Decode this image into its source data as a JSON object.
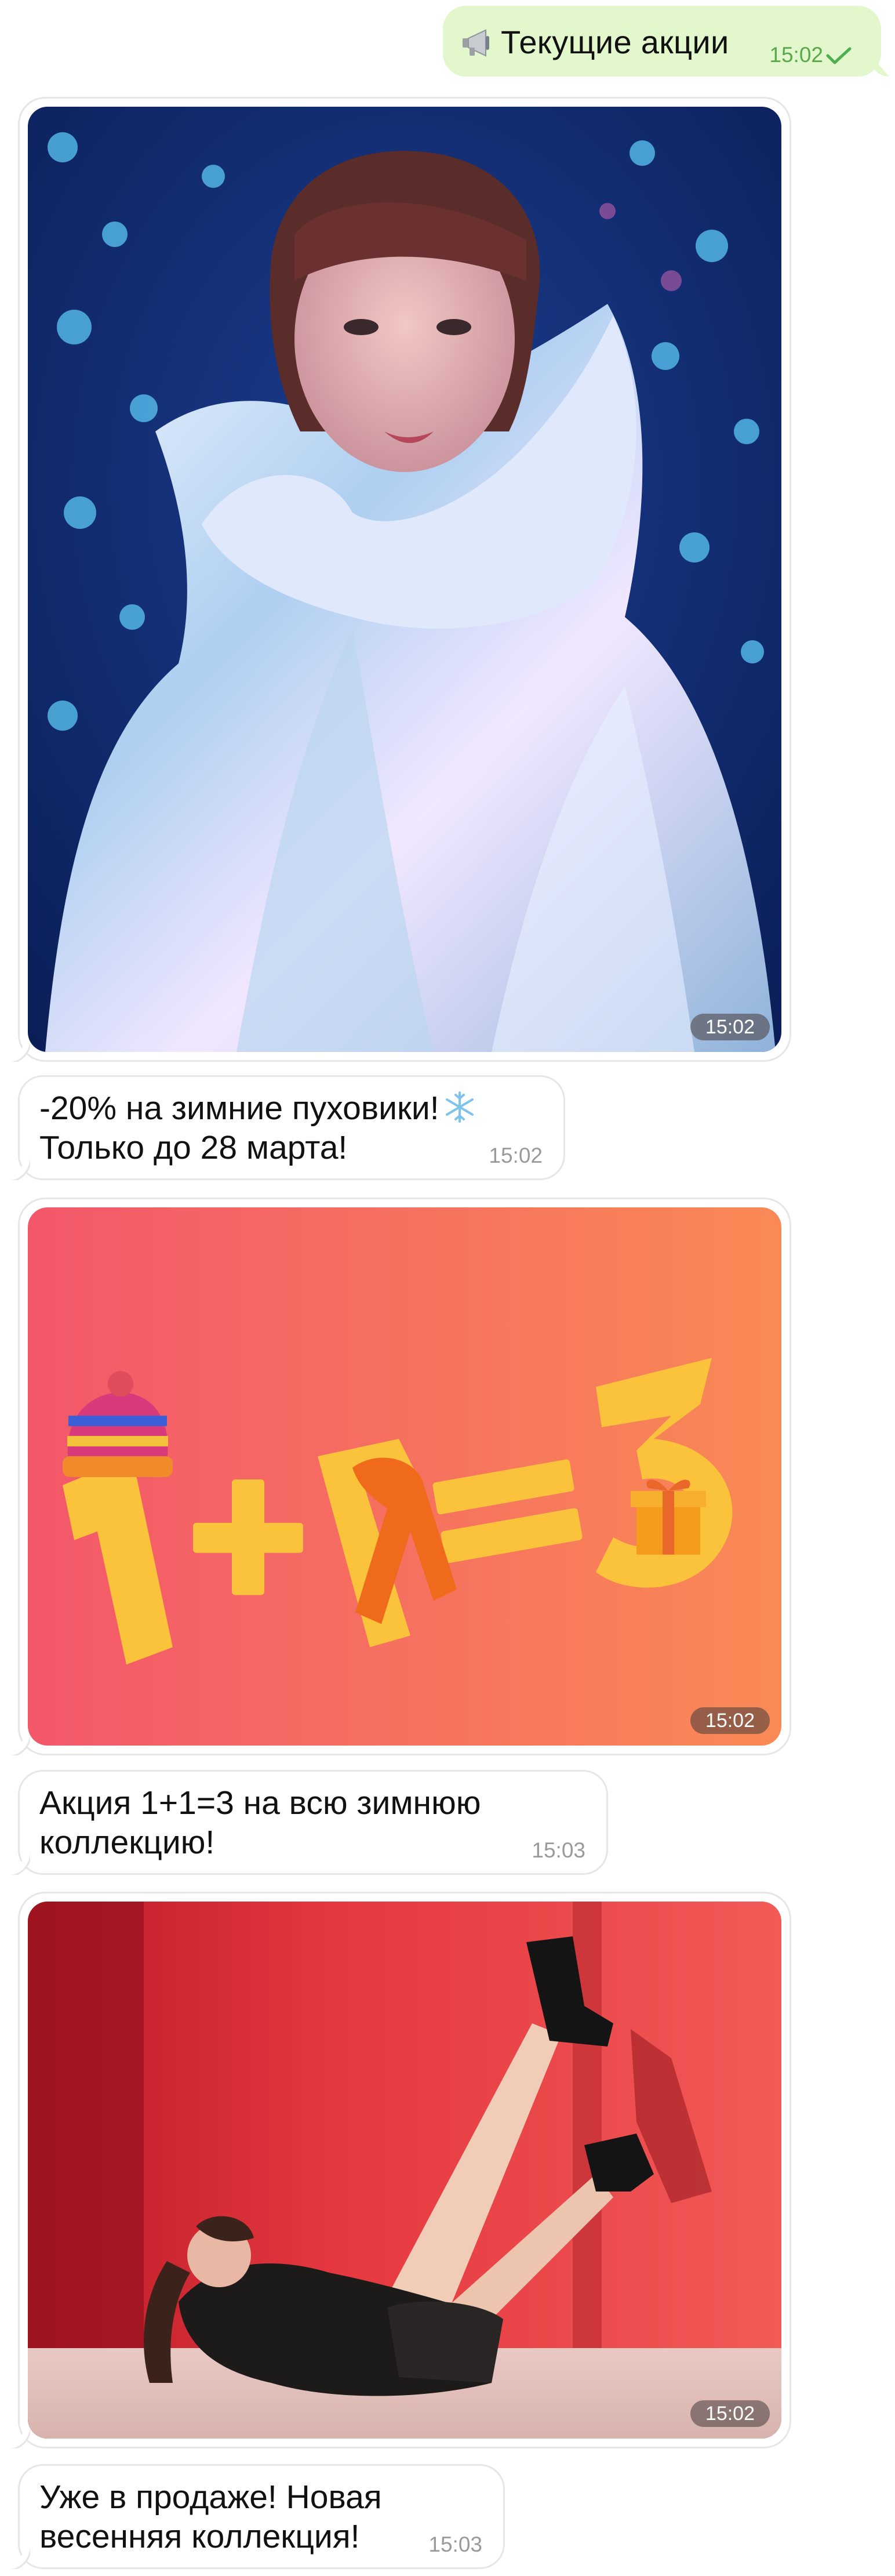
{
  "outgoing": {
    "icon": "megaphone-icon",
    "text": "Текущие акции",
    "time": "15:02",
    "status_icon": "check-icon",
    "status_color": "#4caf50"
  },
  "messages": [
    {
      "image": {
        "description_icon": "photo",
        "time": "15:02"
      },
      "caption": {
        "line1": "-20% на зимние пуховики!",
        "emoji": "snowflake-icon",
        "line2": "Только до 28 марта!",
        "time": "15:02"
      }
    },
    {
      "image": {
        "promo_text": "1+1=3",
        "time": "15:02"
      },
      "caption": {
        "text": "Акция 1+1=3 на всю зимнюю\nколлекцию!",
        "time": "15:03"
      }
    },
    {
      "image": {
        "time": "15:02"
      },
      "caption": {
        "text": "Уже в продаже! Новая\nвесенняя коллекция!",
        "time": "15:03"
      }
    }
  ],
  "colors": {
    "outgoing_bg": "#e2f7cb",
    "promo_bg_start": "#f3576a",
    "promo_bg_end": "#f98a55",
    "promo_digits": "#fbc23c"
  }
}
